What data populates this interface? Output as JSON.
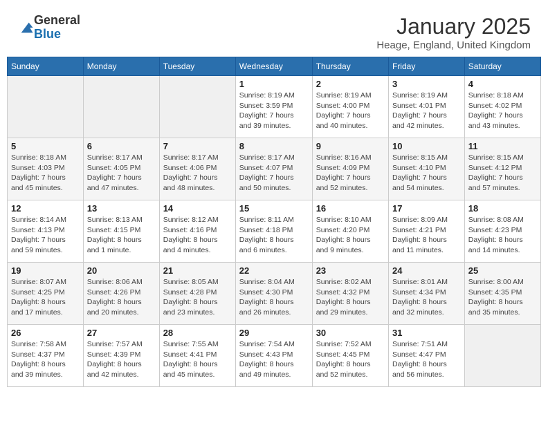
{
  "logo": {
    "general": "General",
    "blue": "Blue"
  },
  "header": {
    "month": "January 2025",
    "location": "Heage, England, United Kingdom"
  },
  "weekdays": [
    "Sunday",
    "Monday",
    "Tuesday",
    "Wednesday",
    "Thursday",
    "Friday",
    "Saturday"
  ],
  "weeks": [
    [
      {
        "day": "",
        "info": ""
      },
      {
        "day": "",
        "info": ""
      },
      {
        "day": "",
        "info": ""
      },
      {
        "day": "1",
        "info": "Sunrise: 8:19 AM\nSunset: 3:59 PM\nDaylight: 7 hours\nand 39 minutes."
      },
      {
        "day": "2",
        "info": "Sunrise: 8:19 AM\nSunset: 4:00 PM\nDaylight: 7 hours\nand 40 minutes."
      },
      {
        "day": "3",
        "info": "Sunrise: 8:19 AM\nSunset: 4:01 PM\nDaylight: 7 hours\nand 42 minutes."
      },
      {
        "day": "4",
        "info": "Sunrise: 8:18 AM\nSunset: 4:02 PM\nDaylight: 7 hours\nand 43 minutes."
      }
    ],
    [
      {
        "day": "5",
        "info": "Sunrise: 8:18 AM\nSunset: 4:03 PM\nDaylight: 7 hours\nand 45 minutes."
      },
      {
        "day": "6",
        "info": "Sunrise: 8:17 AM\nSunset: 4:05 PM\nDaylight: 7 hours\nand 47 minutes."
      },
      {
        "day": "7",
        "info": "Sunrise: 8:17 AM\nSunset: 4:06 PM\nDaylight: 7 hours\nand 48 minutes."
      },
      {
        "day": "8",
        "info": "Sunrise: 8:17 AM\nSunset: 4:07 PM\nDaylight: 7 hours\nand 50 minutes."
      },
      {
        "day": "9",
        "info": "Sunrise: 8:16 AM\nSunset: 4:09 PM\nDaylight: 7 hours\nand 52 minutes."
      },
      {
        "day": "10",
        "info": "Sunrise: 8:15 AM\nSunset: 4:10 PM\nDaylight: 7 hours\nand 54 minutes."
      },
      {
        "day": "11",
        "info": "Sunrise: 8:15 AM\nSunset: 4:12 PM\nDaylight: 7 hours\nand 57 minutes."
      }
    ],
    [
      {
        "day": "12",
        "info": "Sunrise: 8:14 AM\nSunset: 4:13 PM\nDaylight: 7 hours\nand 59 minutes."
      },
      {
        "day": "13",
        "info": "Sunrise: 8:13 AM\nSunset: 4:15 PM\nDaylight: 8 hours\nand 1 minute."
      },
      {
        "day": "14",
        "info": "Sunrise: 8:12 AM\nSunset: 4:16 PM\nDaylight: 8 hours\nand 4 minutes."
      },
      {
        "day": "15",
        "info": "Sunrise: 8:11 AM\nSunset: 4:18 PM\nDaylight: 8 hours\nand 6 minutes."
      },
      {
        "day": "16",
        "info": "Sunrise: 8:10 AM\nSunset: 4:20 PM\nDaylight: 8 hours\nand 9 minutes."
      },
      {
        "day": "17",
        "info": "Sunrise: 8:09 AM\nSunset: 4:21 PM\nDaylight: 8 hours\nand 11 minutes."
      },
      {
        "day": "18",
        "info": "Sunrise: 8:08 AM\nSunset: 4:23 PM\nDaylight: 8 hours\nand 14 minutes."
      }
    ],
    [
      {
        "day": "19",
        "info": "Sunrise: 8:07 AM\nSunset: 4:25 PM\nDaylight: 8 hours\nand 17 minutes."
      },
      {
        "day": "20",
        "info": "Sunrise: 8:06 AM\nSunset: 4:26 PM\nDaylight: 8 hours\nand 20 minutes."
      },
      {
        "day": "21",
        "info": "Sunrise: 8:05 AM\nSunset: 4:28 PM\nDaylight: 8 hours\nand 23 minutes."
      },
      {
        "day": "22",
        "info": "Sunrise: 8:04 AM\nSunset: 4:30 PM\nDaylight: 8 hours\nand 26 minutes."
      },
      {
        "day": "23",
        "info": "Sunrise: 8:02 AM\nSunset: 4:32 PM\nDaylight: 8 hours\nand 29 minutes."
      },
      {
        "day": "24",
        "info": "Sunrise: 8:01 AM\nSunset: 4:34 PM\nDaylight: 8 hours\nand 32 minutes."
      },
      {
        "day": "25",
        "info": "Sunrise: 8:00 AM\nSunset: 4:35 PM\nDaylight: 8 hours\nand 35 minutes."
      }
    ],
    [
      {
        "day": "26",
        "info": "Sunrise: 7:58 AM\nSunset: 4:37 PM\nDaylight: 8 hours\nand 39 minutes."
      },
      {
        "day": "27",
        "info": "Sunrise: 7:57 AM\nSunset: 4:39 PM\nDaylight: 8 hours\nand 42 minutes."
      },
      {
        "day": "28",
        "info": "Sunrise: 7:55 AM\nSunset: 4:41 PM\nDaylight: 8 hours\nand 45 minutes."
      },
      {
        "day": "29",
        "info": "Sunrise: 7:54 AM\nSunset: 4:43 PM\nDaylight: 8 hours\nand 49 minutes."
      },
      {
        "day": "30",
        "info": "Sunrise: 7:52 AM\nSunset: 4:45 PM\nDaylight: 8 hours\nand 52 minutes."
      },
      {
        "day": "31",
        "info": "Sunrise: 7:51 AM\nSunset: 4:47 PM\nDaylight: 8 hours\nand 56 minutes."
      },
      {
        "day": "",
        "info": ""
      }
    ]
  ]
}
